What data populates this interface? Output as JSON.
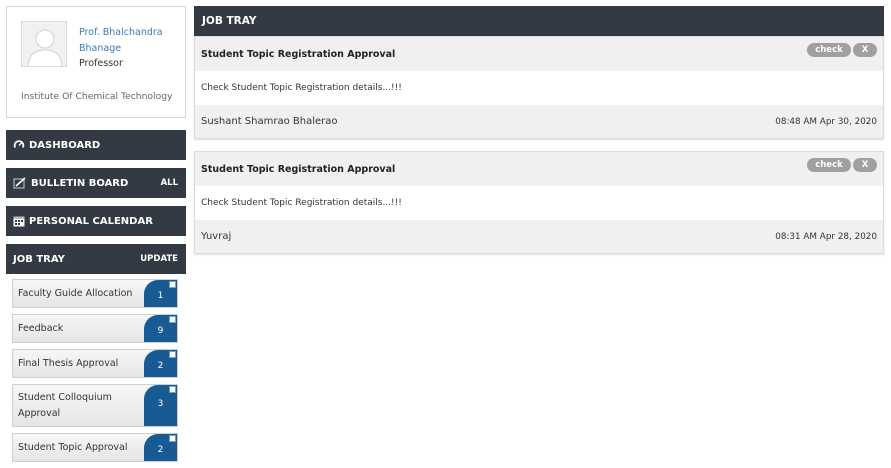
{
  "profile": {
    "name_line1": "Prof. Bhalchandra",
    "name_line2": "Bhanage",
    "role": "Professor",
    "institute": "Institute Of Chemical Technology"
  },
  "nav": {
    "dashboard": "DASHBOARD",
    "bulletin_board": "BULLETIN BOARD",
    "bulletin_all": "ALL",
    "personal_calendar": "PERSONAL CALENDAR",
    "job_tray": "JOB TRAY",
    "job_tray_update": "UPDATE"
  },
  "job_items": [
    {
      "label": "Faculty Guide Allocation",
      "count": "1"
    },
    {
      "label": "Feedback",
      "count": "9"
    },
    {
      "label": "Final Thesis Approval",
      "count": "2"
    },
    {
      "label": "Student Colloquium Approval",
      "count": "3"
    },
    {
      "label": "Student Topic Approval",
      "count": "2"
    }
  ],
  "main": {
    "header": "JOB TRAY",
    "cards": [
      {
        "title": "Student Topic Registration Approval",
        "check_label": "check",
        "close_label": "X",
        "body": "Check Student Topic Registration details...!!!",
        "person": "Sushant Shamrao Bhalerao",
        "time": "08:48 AM Apr 30, 2020"
      },
      {
        "title": "Student Topic Registration Approval",
        "check_label": "check",
        "close_label": "X",
        "body": "Check Student Topic Registration details...!!!",
        "person": "Yuvraj",
        "time": "08:31 AM Apr 28, 2020"
      }
    ]
  },
  "colors": {
    "nav_dark": "#343a44",
    "badge_blue": "#185b94",
    "link_blue": "#3a7ab8",
    "pill_gray": "#a0a0a0"
  }
}
